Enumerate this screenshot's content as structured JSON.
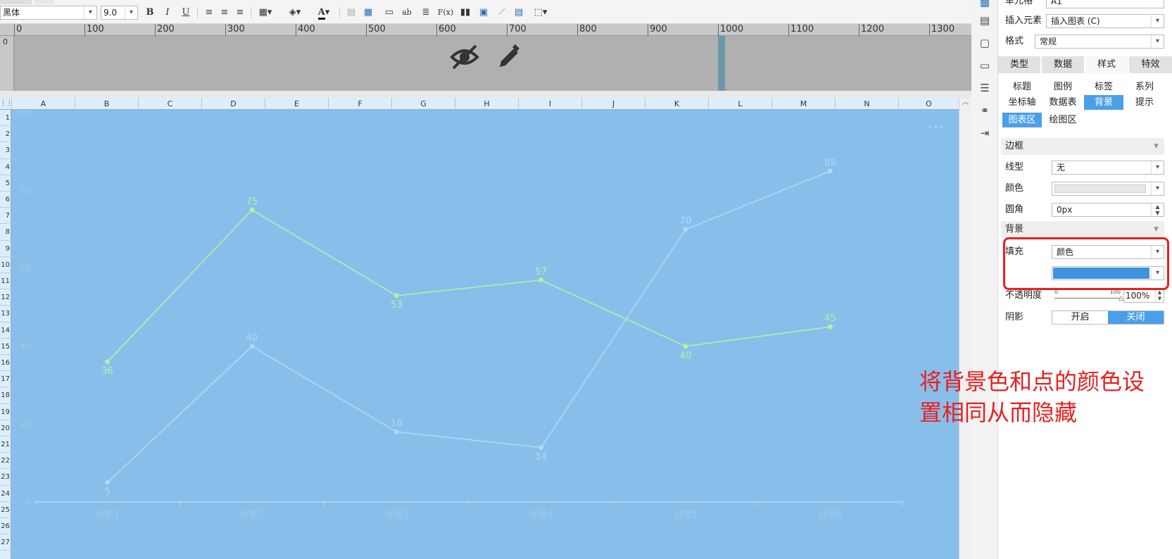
{
  "toolbar": {
    "font": "黑体",
    "size": "9.0",
    "bold": "B",
    "italic": "I",
    "underline": "U",
    "text_color": "A",
    "abc": "ab",
    "fx": "F(x)"
  },
  "ruler": {
    "top_ticks": [
      "0",
      "100",
      "200",
      "300",
      "400",
      "500",
      "600",
      "700",
      "800",
      "900",
      "1000",
      "1100",
      "1200",
      "1300"
    ],
    "left_tick": "0"
  },
  "sheet": {
    "columns": [
      "A",
      "B",
      "C",
      "D",
      "E",
      "F",
      "G",
      "H",
      "I",
      "J",
      "K",
      "L",
      "M",
      "N",
      "O"
    ],
    "rows": [
      "1",
      "2",
      "3",
      "4",
      "5",
      "6",
      "7",
      "8",
      "9",
      "10",
      "11",
      "12",
      "13",
      "14",
      "15",
      "16",
      "17",
      "18",
      "19",
      "20",
      "21",
      "22",
      "23",
      "24",
      "25",
      "26",
      "27"
    ]
  },
  "chart_data": {
    "type": "line",
    "categories": [
      "分类1",
      "分类2",
      "分类3",
      "分类4",
      "分类5",
      "分类6"
    ],
    "yticks": [
      "0",
      "20",
      "40",
      "60",
      "80",
      "100"
    ],
    "ylim": [
      0,
      100
    ],
    "series": [
      {
        "values": [
          36,
          75,
          53,
          57,
          40,
          45
        ],
        "color": "#b7eea6"
      },
      {
        "values": [
          5,
          40,
          18,
          14,
          70,
          85
        ],
        "color": "#b2d7f2"
      }
    ],
    "background": "#88bfea"
  },
  "panel": {
    "cell_label": "单元格",
    "cell_value": "A1",
    "insert_label": "插入元素",
    "insert_value": "插入图表 (C)",
    "format_label": "格式",
    "format_value": "常规",
    "tabs": [
      "类型",
      "数据",
      "样式",
      "特效"
    ],
    "subtabs": [
      "标题",
      "图例",
      "标签",
      "系列",
      "坐标轴",
      "数据表",
      "背景",
      "提示"
    ],
    "area_tabs": [
      "图表区",
      "绘图区"
    ],
    "border_section": "边框",
    "line_type_label": "线型",
    "line_type_value": "无",
    "color_label": "颜色",
    "radius_label": "圆角",
    "radius_value": "0px",
    "bg_section": "背景",
    "fill_label": "填充",
    "fill_value": "颜色",
    "fill_color": "#3d93e0",
    "opacity_label": "不透明度",
    "opacity_min": "0",
    "opacity_max": "100",
    "opacity_value": "100%",
    "shadow_label": "阴影",
    "shadow_on": "开启",
    "shadow_off": "关闭"
  },
  "annotation": {
    "line1": "将背景色和点的颜色设",
    "line2": "置相同从而隐藏",
    "color": "#e82020"
  }
}
